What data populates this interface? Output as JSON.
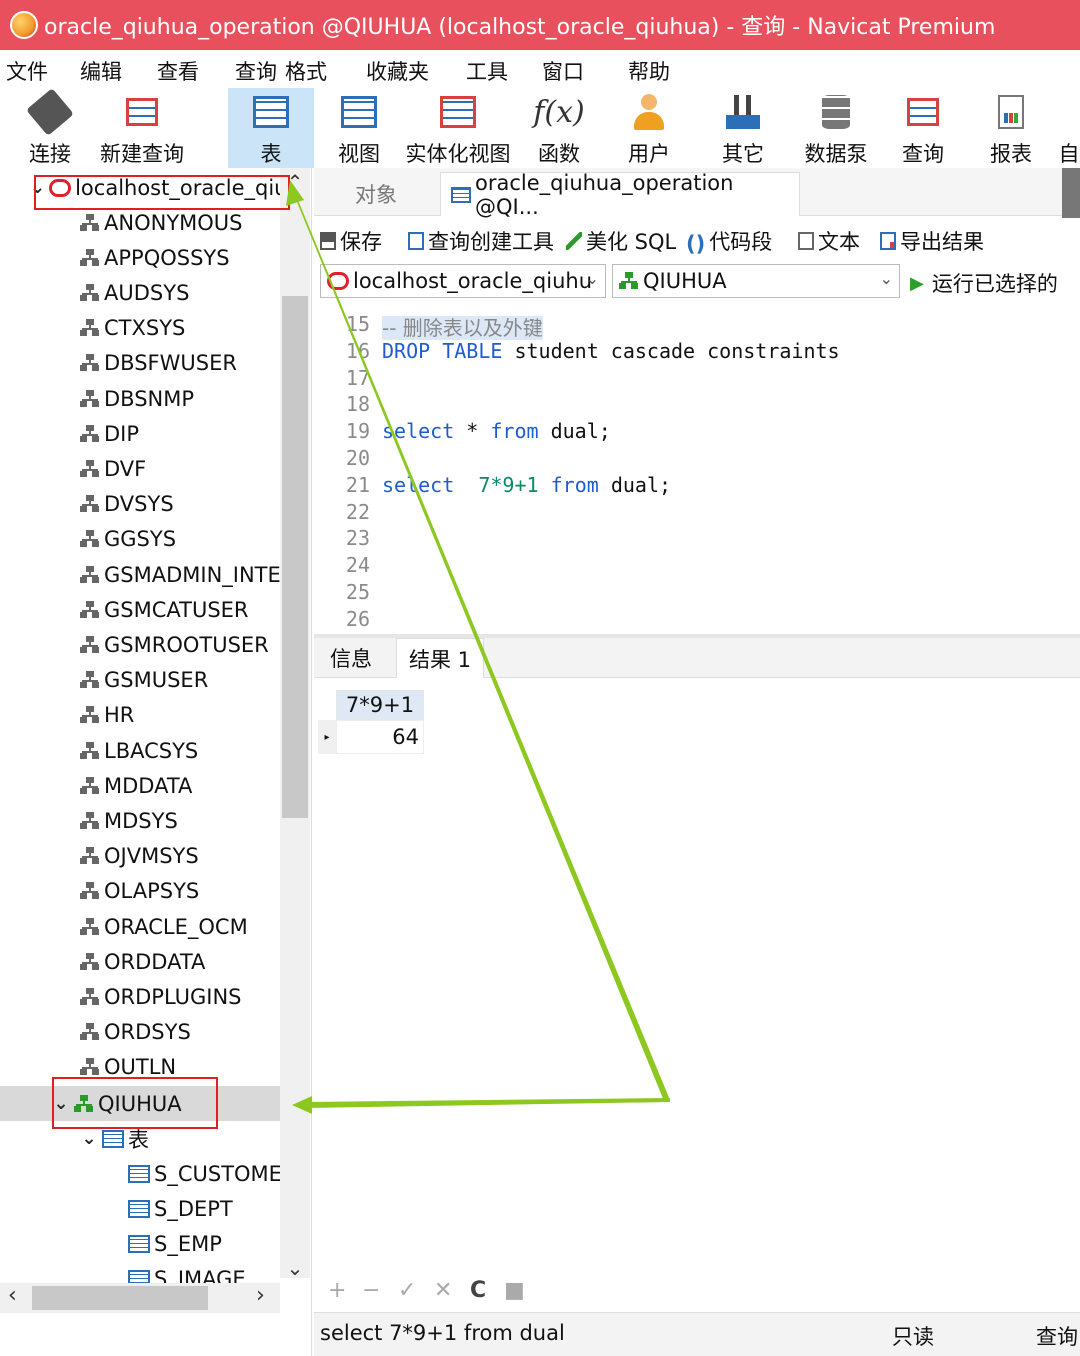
{
  "window": {
    "title": "oracle_qiuhua_operation @QIUHUA (localhost_oracle_qiuhua) - 查询 - Navicat Premium"
  },
  "menu": [
    "文件",
    "编辑",
    "查看",
    "查询",
    "格式",
    "收藏夹",
    "工具",
    "窗口",
    "帮助"
  ],
  "toolbar": {
    "connect": "连接",
    "new_query": "新建查询",
    "table": "表",
    "view": "视图",
    "mview": "实体化视图",
    "function": "函数",
    "user": "用户",
    "other": "其它",
    "datapump": "数据泵",
    "query": "查询",
    "report": "报表",
    "auto": "自"
  },
  "tree": {
    "connection": "localhost_oracle_qiu",
    "schemas": [
      "ANONYMOUS",
      "APPQOSSYS",
      "AUDSYS",
      "CTXSYS",
      "DBSFWUSER",
      "DBSNMP",
      "DIP",
      "DVF",
      "DVSYS",
      "GGSYS",
      "GSMADMIN_INTE",
      "GSMCATUSER",
      "GSMROOTUSER",
      "GSMUSER",
      "HR",
      "LBACSYS",
      "MDDATA",
      "MDSYS",
      "OJVMSYS",
      "OLAPSYS",
      "ORACLE_OCM",
      "ORDDATA",
      "ORDPLUGINS",
      "ORDSYS",
      "OUTLN"
    ],
    "selected_schema": "QIUHUA",
    "tables_folder": "表",
    "tables": [
      "S_CUSTOME",
      "S_DEPT",
      "S_EMP",
      "S_IMAGE"
    ]
  },
  "tabs": {
    "object": "对象",
    "query": "oracle_qiuhua_operation @QI..."
  },
  "query_toolbar": {
    "save": "保存",
    "builder": "查询创建工具",
    "beautify": "美化 SQL",
    "snippet": "代码段",
    "text": "文本",
    "export": "导出结果"
  },
  "selectors": {
    "connection": "localhost_oracle_qiuhu",
    "schema": "QIUHUA",
    "run": "运行已选择的"
  },
  "editor": {
    "lines": [
      {
        "num": "15",
        "kind": "comment",
        "text": "-- 删除表以及外键"
      },
      {
        "num": "16",
        "kind": "drop",
        "kw1": "DROP",
        "kw2": "TABLE",
        "rest": " student cascade constraints"
      },
      {
        "num": "17",
        "kind": "blank"
      },
      {
        "num": "18",
        "kind": "blank"
      },
      {
        "num": "19",
        "kind": "select1",
        "kw1": "select",
        "mid": " * ",
        "kw2": "from",
        "rest": " dual;"
      },
      {
        "num": "20",
        "kind": "blank"
      },
      {
        "num": "21",
        "kind": "select2",
        "kw1": "select",
        "expr": "7*9+1",
        "kw2": "from",
        "rest": " dual;"
      },
      {
        "num": "22",
        "kind": "blank"
      },
      {
        "num": "23",
        "kind": "blank"
      },
      {
        "num": "24",
        "kind": "blank"
      },
      {
        "num": "25",
        "kind": "blank"
      },
      {
        "num": "26",
        "kind": "blank"
      }
    ]
  },
  "results": {
    "tab_info": "信息",
    "tab_result": "结果 1",
    "column": "7*9+1",
    "value": "64"
  },
  "bottom_tools": [
    "+",
    "−",
    "✓",
    "✕",
    "C",
    "■"
  ],
  "status": {
    "sql": "select  7*9+1 from dual",
    "readonly": "只读",
    "mode": "查询"
  },
  "colors": {
    "titlebar": "#e8505e",
    "annotation": "#e02020",
    "arrow": "#8cc820",
    "keyword": "#1f5bd1"
  }
}
